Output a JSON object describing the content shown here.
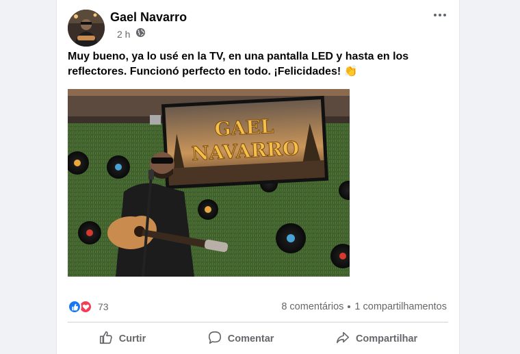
{
  "post": {
    "author": "Gael Navarro",
    "time": "2 h",
    "privacy_icon": "globe-icon",
    "text": "Muy bueno, ya lo usé en la TV, en una pantalla LED y hasta en los reflectores. Funcionó perfecto en todo. ¡Felicidades! 👏",
    "image": {
      "sign_line1": "GAEL",
      "sign_line2": "NAVARRO"
    }
  },
  "reactions": {
    "icons": [
      "like-icon",
      "love-icon"
    ],
    "count": "73"
  },
  "stats": {
    "comments": "8 comentários",
    "shares": "1 compartilhamentos"
  },
  "actions": {
    "like": "Curtir",
    "comment": "Comentar",
    "share": "Compartilhar"
  },
  "colors": {
    "like_blue": "#1877f2",
    "love_red": "#f33e58",
    "secondary_text": "#65676b"
  }
}
